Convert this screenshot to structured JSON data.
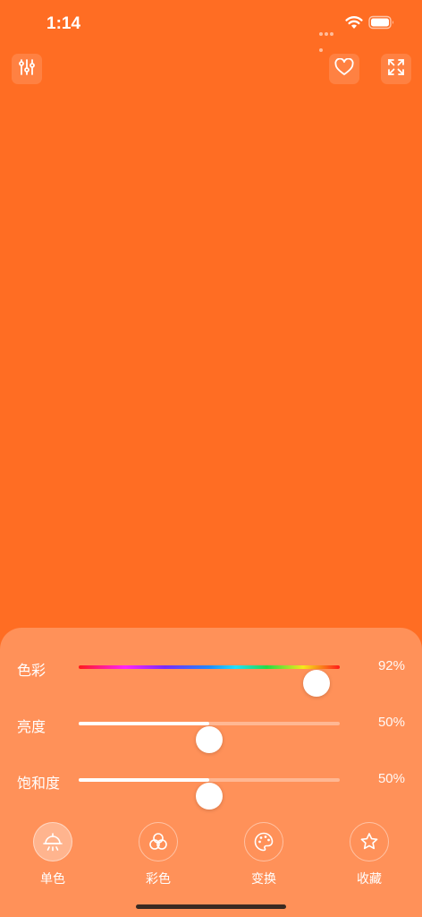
{
  "status": {
    "time": "1:14",
    "icons": [
      "cellular-dots-icon",
      "wifi-icon",
      "battery-icon"
    ]
  },
  "top_bar": {
    "left_icon": "sliders-icon",
    "right_icons": [
      "heart-icon",
      "fullscreen-icon"
    ]
  },
  "screen_color": "#FF6D23",
  "panel_color": "#FF9159",
  "sliders": [
    {
      "label": "色彩",
      "value_text": "92%",
      "value": 0.91,
      "type": "hue"
    },
    {
      "label": "亮度",
      "value_text": "50%",
      "value": 0.5,
      "type": "level"
    },
    {
      "label": "饱和度",
      "value_text": "50%",
      "value": 0.5,
      "type": "level"
    }
  ],
  "tabs": [
    {
      "label": "单色",
      "icon": "lamp-icon",
      "active": true
    },
    {
      "label": "彩色",
      "icon": "color-circles-icon",
      "active": false
    },
    {
      "label": "变换",
      "icon": "palette-icon",
      "active": false
    },
    {
      "label": "收藏",
      "icon": "star-icon",
      "active": false
    }
  ]
}
